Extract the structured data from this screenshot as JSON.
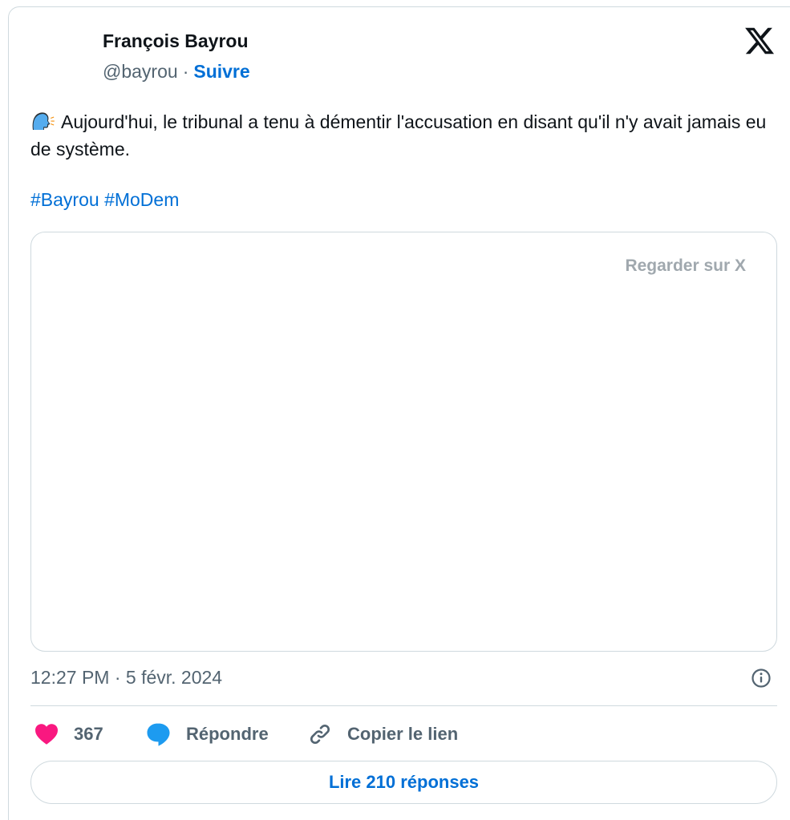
{
  "author": {
    "name": "François Bayrou",
    "handle": "@bayrou",
    "separator": "·",
    "follow_label": "Suivre"
  },
  "tweet": {
    "text": "Aujourd'hui, le tribunal a tenu à démentir l'accusation en disant qu'il n'y avait jamais eu de système.",
    "hashtags": [
      "#Bayrou",
      "#MoDem"
    ],
    "leading_icon": "speaking-head-emoji"
  },
  "media": {
    "watch_label": "Regarder sur X"
  },
  "meta": {
    "timestamp": "12:27 PM · 5 févr. 2024"
  },
  "actions": {
    "like_count": "367",
    "reply_label": "Répondre",
    "copy_label": "Copier le lien",
    "read_replies_label": "Lire 210 réponses"
  },
  "colors": {
    "link_blue": "#006fd6",
    "like_pink": "#f91880",
    "reply_blue": "#1d9bf0",
    "secondary_text": "#536471",
    "border": "#cfd9de"
  }
}
